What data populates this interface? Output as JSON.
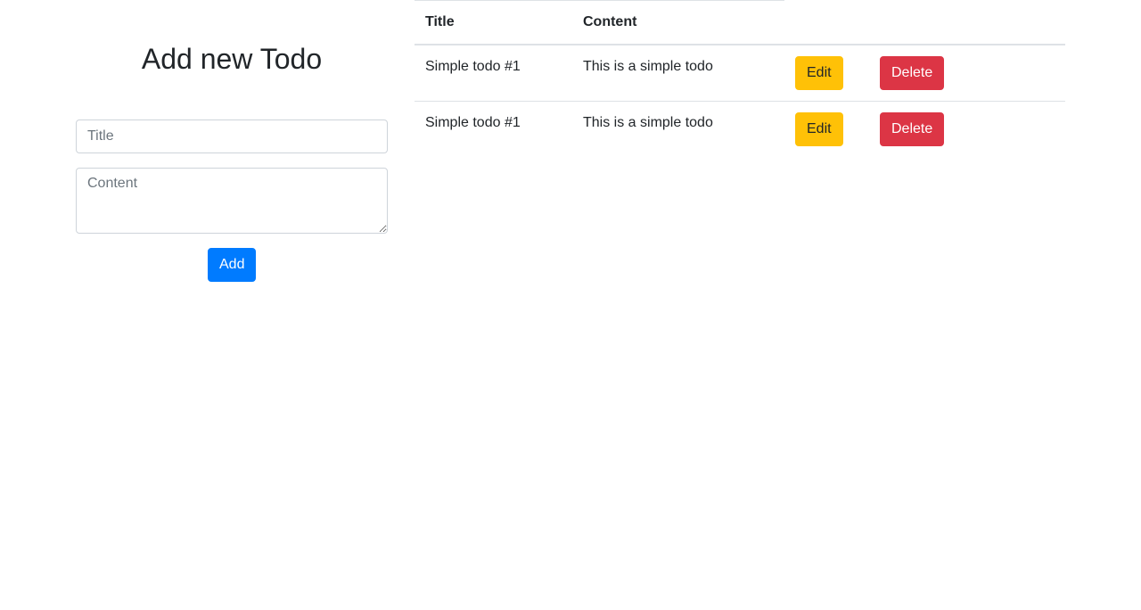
{
  "form": {
    "heading": "Add new Todo",
    "title_placeholder": "Title",
    "content_placeholder": "Content",
    "title_value": "",
    "content_value": "",
    "add_label": "Add"
  },
  "table": {
    "headers": [
      "Title",
      "Content"
    ],
    "rows": [
      {
        "title": "Simple todo #1",
        "content": "This is a simple todo",
        "edit_label": "Edit",
        "delete_label": "Delete"
      },
      {
        "title": "Simple todo #1",
        "content": "This is a simple todo",
        "edit_label": "Edit",
        "delete_label": "Delete"
      }
    ]
  },
  "colors": {
    "primary": "#007bff",
    "warning": "#ffc107",
    "danger": "#dc3545"
  }
}
